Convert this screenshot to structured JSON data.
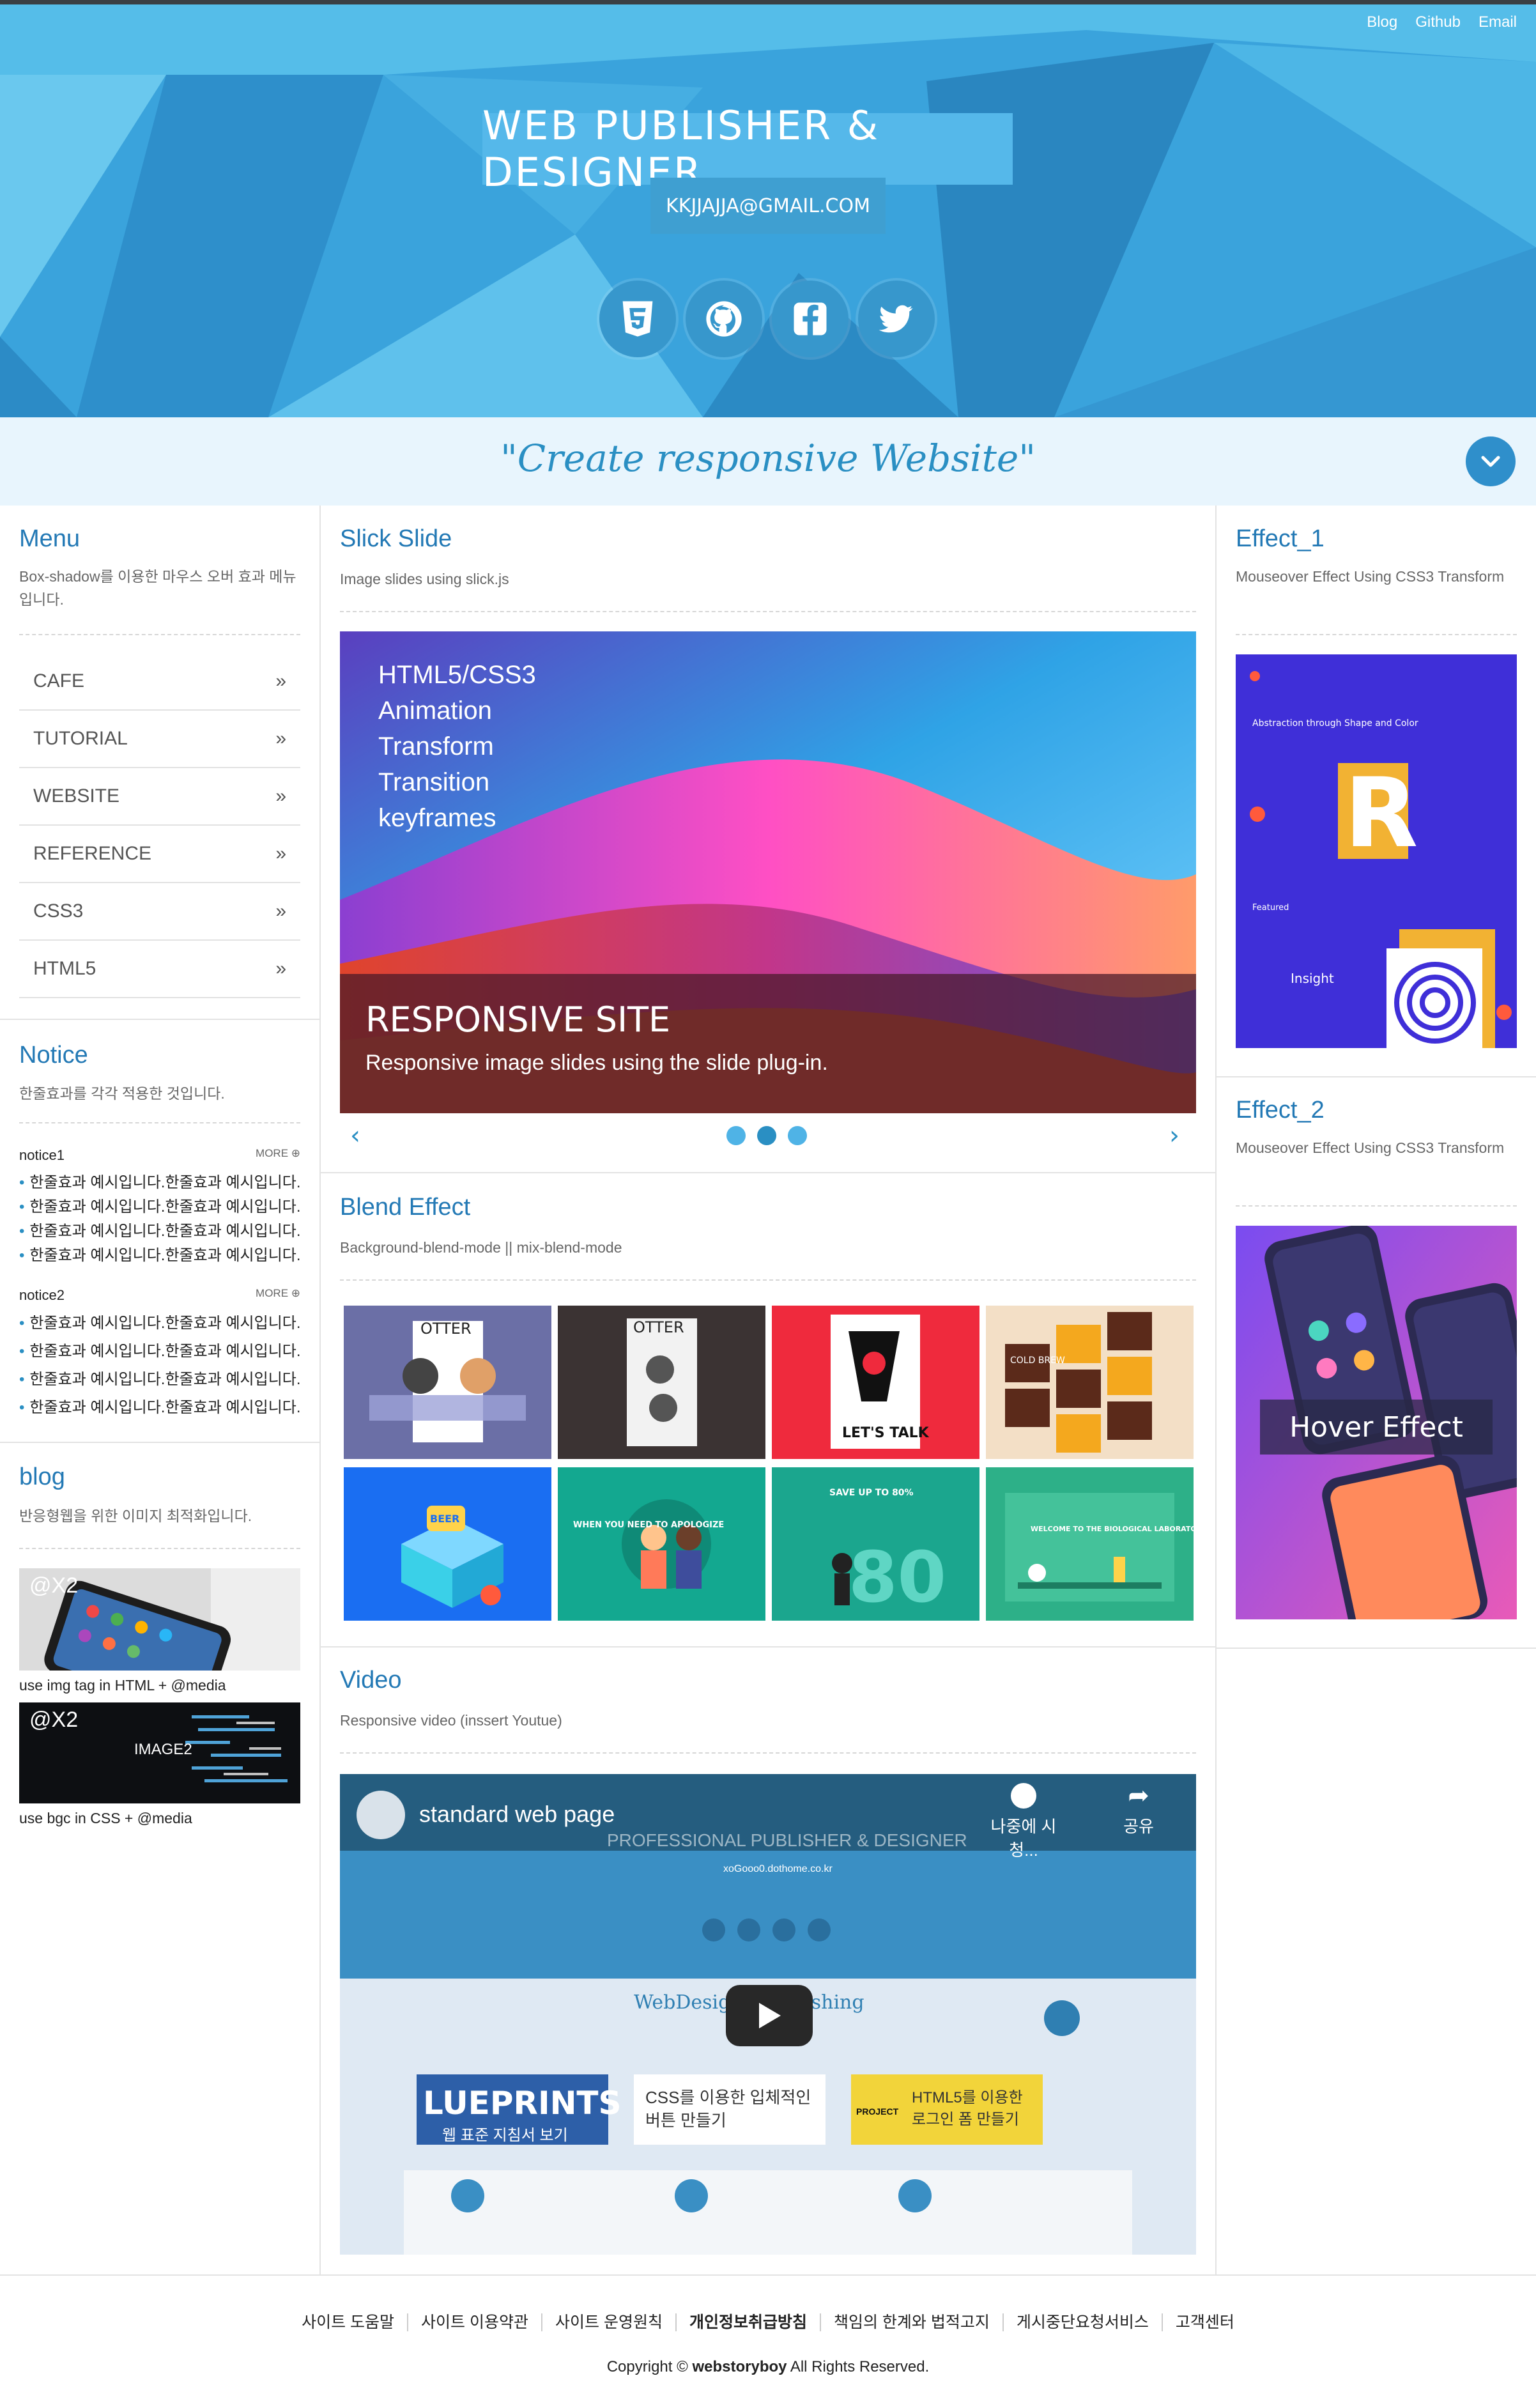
{
  "top_nav": [
    "Blog",
    "Github",
    "Email"
  ],
  "header": {
    "title": "WEB PUBLISHER & DESIGNER",
    "email": "KKJJAJJA@GMAIL.COM",
    "social_icons": [
      "html5-icon",
      "github-icon",
      "facebook-icon",
      "twitter-icon"
    ]
  },
  "slogan": "\"Create responsive Website\"",
  "menu": {
    "title": "Menu",
    "desc": "Box-shadow를 이용한 마우스 오버 효과 메뉴입니다.",
    "items": [
      "CAFE",
      "TUTORIAL",
      "WEBSITE",
      "REFERENCE",
      "CSS3",
      "HTML5"
    ]
  },
  "notice": {
    "title": "Notice",
    "desc": "한줄효과를 각각 적용한 것입니다.",
    "more": "MORE",
    "groups": [
      {
        "name": "notice1",
        "lines": [
          "한줄효과 예시입니다.한줄효과 예시입니다.",
          "한줄효과 예시입니다.한줄효과 예시입니다.",
          "한줄효과 예시입니다.한줄효과 예시입니다.",
          "한줄효과 예시입니다.한줄효과 예시입니다."
        ]
      },
      {
        "name": "notice2",
        "lines": [
          "한줄효과 예시입니다.한줄효과 예시입니다.",
          "한줄효과 예시입니다.한줄효과 예시입니다.",
          "한줄효과 예시입니다.한줄효과 예시입니다.",
          "한줄효과 예시입니다.한줄효과 예시입니다."
        ]
      }
    ]
  },
  "blog": {
    "title": "blog",
    "desc": "반응형웹을 위한 이미지 최적화입니다.",
    "items": [
      {
        "badge": "@X2",
        "label": "",
        "caption": "use img tag in HTML + @media"
      },
      {
        "badge": "@X2",
        "label": "IMAGE2",
        "caption": "use bgc in CSS + @media"
      }
    ]
  },
  "slick": {
    "title": "Slick Slide",
    "desc": "Image slides using slick.js",
    "lines": [
      "HTML5/CSS3",
      "Animation",
      "Transform",
      "Transition",
      "keyframes"
    ],
    "caption_title": "RESPONSIVE SITE",
    "caption_desc": "Responsive image slides using the slide plug-in.",
    "prev": "‹",
    "next": "›"
  },
  "blend": {
    "title": "Blend Effect",
    "desc": "Background-blend-mode || mix-blend-mode",
    "tiles": [
      {
        "text": "OTTER"
      },
      {
        "text": "OTTER"
      },
      {
        "text": "LET'S TALK"
      },
      {
        "text": "COLD BREW"
      },
      {
        "text": "BEER"
      },
      {
        "text": "WHEN YOU NEED TO APOLOGIZE"
      },
      {
        "text": "SAVE UP TO 80%"
      },
      {
        "text": "WELCOME TO THE BIOLOGICAL LABORATORY"
      }
    ]
  },
  "video": {
    "title": "Video",
    "desc": "Responsive video (inssert Youtue)",
    "video_title": "standard web page",
    "watch_later": "나중에 시청...",
    "share": "공유",
    "banner": "PROFESSIONAL PUBLISHER & DESIGNER",
    "banner_sub": "xoGooo0.dothome.co.kr",
    "inner_heading": "WebDesign / Publishing",
    "card1": "LUEPRINTS",
    "card1_sub": "웹 표준 지침서 보기",
    "card2": "CSS를 이용한 입체적인 버튼 만들기",
    "card3": "HTML5를 이용한 로그인 폼 만들기",
    "card3_tag": "PROJECT"
  },
  "effect1": {
    "title": "Effect_1",
    "desc": "Mouseover Effect Using CSS3 Transform",
    "img_text": [
      "Abstraction through Shape and Color",
      "Featured",
      "Insight"
    ]
  },
  "effect2": {
    "title": "Effect_2",
    "desc": "Mouseover Effect Using CSS3 Transform",
    "hover_label": "Hover Effect"
  },
  "footer": {
    "links": [
      "사이트 도움말",
      "사이트 이용약관",
      "사이트 운영원칙",
      "개인정보취급방침",
      "책임의 한계와 법적고지",
      "게시중단요청서비스",
      "고객센터"
    ],
    "copyright_prefix": "Copyright ©",
    "copyright_brand": "webstoryboy",
    "copyright_suffix": "All Rights Reserved."
  },
  "colors": {
    "accent": "#2a8fc3",
    "header_bg": "#3aa3dc",
    "slogan_bg": "#e8f5fd"
  }
}
